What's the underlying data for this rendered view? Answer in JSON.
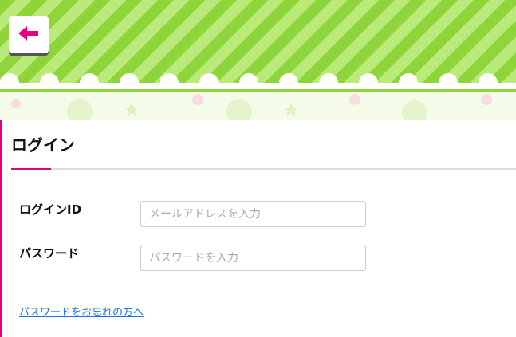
{
  "page": {
    "title": "ログイン"
  },
  "form": {
    "login_id_label": "ログインID",
    "login_id_placeholder": "メールアドレスを入力",
    "password_label": "パスワード",
    "password_placeholder": "パスワードを入力"
  },
  "links": {
    "forgot_password": "パスワードをお忘れの方へ"
  },
  "colors": {
    "accent": "#e6007e",
    "stripe_light": "#b9ea7a",
    "stripe_dark": "#8ed43a",
    "link": "#1a73e8"
  },
  "icons": {
    "back": "arrow-left-icon"
  }
}
